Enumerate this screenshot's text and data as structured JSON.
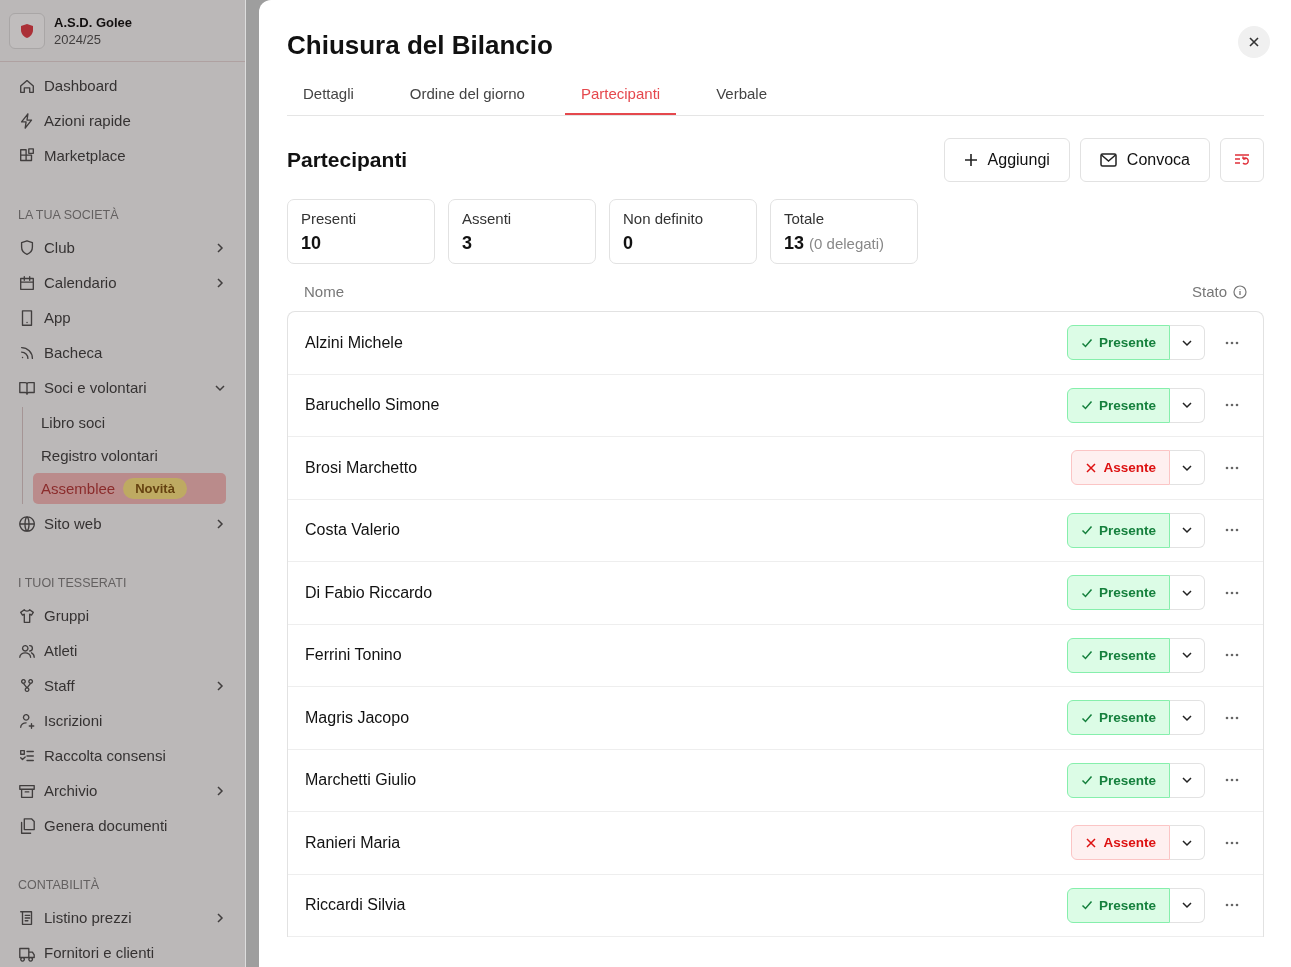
{
  "sidebar": {
    "club": {
      "name": "A.S.D. Golee",
      "season": "2024/25"
    },
    "sections": [
      {
        "items": [
          {
            "label": "Dashboard",
            "kind": "link",
            "selected": false
          },
          {
            "label": "Azioni rapide",
            "kind": "link",
            "selected": false
          },
          {
            "label": "Marketplace",
            "kind": "link",
            "selected": false
          }
        ]
      },
      {
        "title": "LA TUA SOCIETÀ",
        "items": [
          {
            "label": "Club",
            "kind": "menu",
            "selected": false
          },
          {
            "label": "Calendario",
            "kind": "menu",
            "selected": false
          },
          {
            "label": "App",
            "kind": "link",
            "selected": false
          },
          {
            "label": "Bacheca",
            "kind": "link",
            "selected": false
          },
          {
            "label": "Soci e volontari",
            "kind": "group",
            "selected": false,
            "children": [
              {
                "label": "Libro soci",
                "selected": false
              },
              {
                "label": "Registro volontari",
                "selected": false
              },
              {
                "label": "Assemblee",
                "badge": "Novità",
                "selected": true
              }
            ]
          },
          {
            "label": "Sito web",
            "kind": "menu",
            "selected": false
          }
        ]
      },
      {
        "title": "I TUOI TESSERATI",
        "items": [
          {
            "label": "Gruppi",
            "kind": "link",
            "selected": false
          },
          {
            "label": "Atleti",
            "kind": "link",
            "selected": false
          },
          {
            "label": "Staff",
            "kind": "menu",
            "selected": false
          },
          {
            "label": "Iscrizioni",
            "kind": "link",
            "selected": false
          },
          {
            "label": "Raccolta consensi",
            "kind": "link",
            "selected": false
          },
          {
            "label": "Archivio",
            "kind": "menu",
            "selected": false
          },
          {
            "label": "Genera documenti",
            "kind": "link",
            "selected": false
          }
        ]
      },
      {
        "title": "CONTABILITÀ",
        "items": [
          {
            "label": "Listino prezzi",
            "kind": "menu",
            "selected": false
          },
          {
            "label": "Fornitori e clienti",
            "kind": "link",
            "selected": false
          }
        ]
      }
    ]
  },
  "dialog": {
    "title": "Chiusura del Bilancio",
    "tabs": [
      {
        "label": "Dettagli",
        "selected": false
      },
      {
        "label": "Ordine del giorno",
        "selected": false
      },
      {
        "label": "Partecipanti",
        "selected": true
      },
      {
        "label": "Verbale",
        "selected": false
      }
    ],
    "heading": "Partecipanti",
    "buttons": [
      {
        "kind": "add",
        "label": "Aggiungi"
      },
      {
        "kind": "mail",
        "label": "Convoca"
      },
      {
        "kind": "reset"
      }
    ],
    "stats": [
      {
        "label": "Presenti",
        "value": "10"
      },
      {
        "label": "Assenti",
        "value": "3"
      },
      {
        "label": "Non definito",
        "value": "0"
      },
      {
        "label": "Totale",
        "value": "13",
        "note": "(0 delegati)"
      }
    ],
    "columns": [
      "Nome",
      "Stato"
    ],
    "rows": [
      {
        "name": "Alzini Michele",
        "status": {
          "kind": "present",
          "label": "Presente"
        }
      },
      {
        "name": "Baruchello Simone",
        "status": {
          "kind": "present",
          "label": "Presente"
        }
      },
      {
        "name": "Brosi Marchetto",
        "status": {
          "kind": "absent",
          "label": "Assente"
        }
      },
      {
        "name": "Costa Valerio",
        "status": {
          "kind": "present",
          "label": "Presente"
        }
      },
      {
        "name": "Di Fabio Riccardo",
        "status": {
          "kind": "present",
          "label": "Presente"
        }
      },
      {
        "name": "Ferrini Tonino",
        "status": {
          "kind": "present",
          "label": "Presente"
        }
      },
      {
        "name": "Magris Jacopo",
        "status": {
          "kind": "present",
          "label": "Presente"
        }
      },
      {
        "name": "Marchetti Giulio",
        "status": {
          "kind": "present",
          "label": "Presente"
        }
      },
      {
        "name": "Ranieri Maria",
        "status": {
          "kind": "absent",
          "label": "Assente"
        }
      },
      {
        "name": "Riccardi Silvia",
        "status": {
          "kind": "present",
          "label": "Presente"
        }
      }
    ]
  }
}
